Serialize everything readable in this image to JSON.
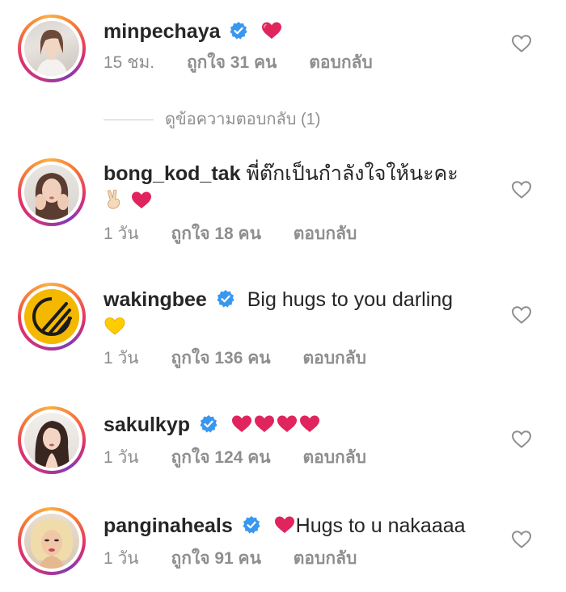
{
  "comments": [
    {
      "username": "minpechaya",
      "verified": true,
      "text": "",
      "emoji": [
        "red-heart"
      ],
      "time": "15 ชม.",
      "likes": "ถูกใจ 31 คน",
      "reply": "ตอบกลับ"
    },
    {
      "username": "bong_kod_tak",
      "verified": false,
      "text": "พี่ต๊กเป็นกำลังใจให้นะคะ",
      "emoji": [
        "victory-hand",
        "red-heart"
      ],
      "time": "1 วัน",
      "likes": "ถูกใจ 18 คน",
      "reply": "ตอบกลับ"
    },
    {
      "username": "wakingbee",
      "verified": true,
      "text": "Big hugs to you darling",
      "emoji": [
        "yellow-heart"
      ],
      "time": "1 วัน",
      "likes": "ถูกใจ 136 คน",
      "reply": "ตอบกลับ"
    },
    {
      "username": "sakulkyp",
      "verified": true,
      "text": "",
      "emoji": [
        "red-heart",
        "red-heart",
        "red-heart",
        "red-heart"
      ],
      "time": "1 วัน",
      "likes": "ถูกใจ 124 คน",
      "reply": "ตอบกลับ"
    },
    {
      "username": "panginaheals",
      "verified": true,
      "text": "Hugs to u nakaaaa",
      "emoji": [
        "red-heart"
      ],
      "time": "1 วัน",
      "likes": "ถูกใจ 91 คน",
      "reply": "ตอบกลับ"
    }
  ],
  "view_replies_label": "ดูข้อความตอบกลับ (1)",
  "colors": {
    "verified_blue": "#3897f0",
    "heart_red": "#e0245e",
    "yellow_heart": "#ffcc00",
    "meta_gray": "#8e8e8e"
  }
}
